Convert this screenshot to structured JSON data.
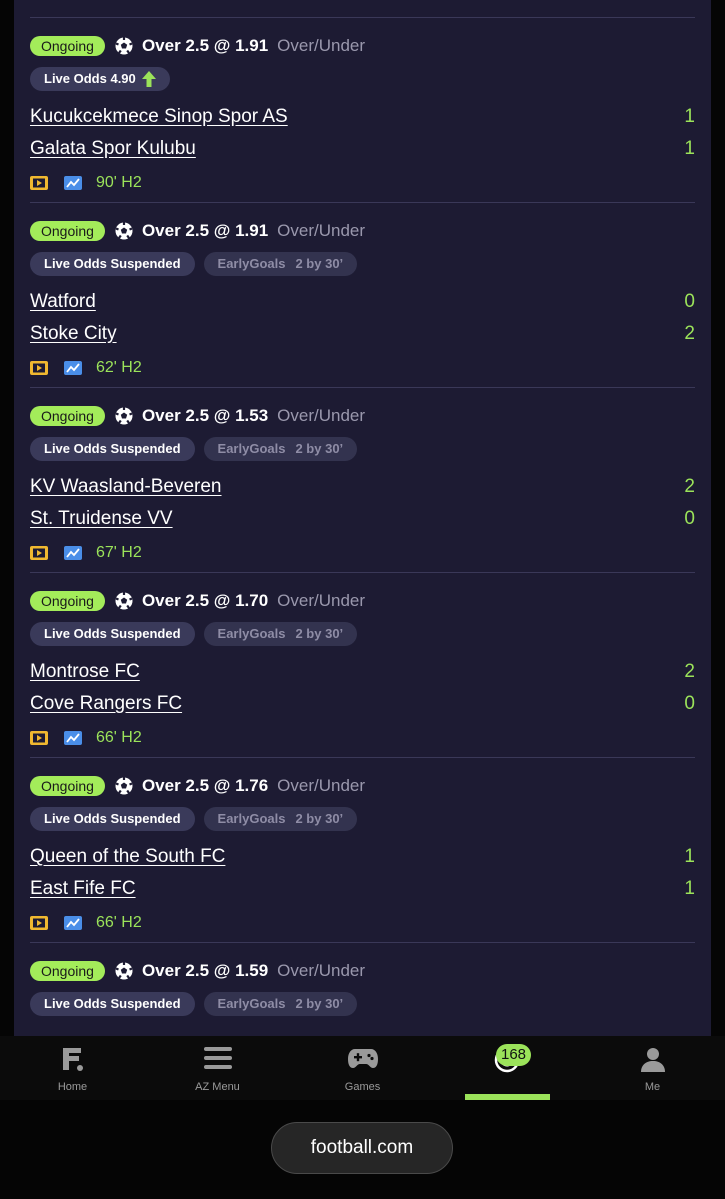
{
  "matches": [
    {
      "status": "Ongoing",
      "market": "Over 2.5 @ 1.91",
      "market_type": "Over/Under",
      "live_odds": "Live Odds 4.90",
      "odds_trend": "up",
      "early_goals": null,
      "home": "Kucukcekmece Sinop Spor AS",
      "home_score": "1",
      "away": "Galata Spor Kulubu",
      "away_score": "1",
      "minute": "90' H2"
    },
    {
      "status": "Ongoing",
      "market": "Over 2.5 @ 1.91",
      "market_type": "Over/Under",
      "live_odds": "Live Odds Suspended",
      "early_goals": {
        "label": "EarlyGoals",
        "value": "2 by 30’"
      },
      "home": "Watford",
      "home_score": "0",
      "away": "Stoke City",
      "away_score": "2",
      "minute": "62' H2"
    },
    {
      "status": "Ongoing",
      "market": "Over 2.5 @ 1.53",
      "market_type": "Over/Under",
      "live_odds": "Live Odds Suspended",
      "early_goals": {
        "label": "EarlyGoals",
        "value": "2 by 30’"
      },
      "home": "KV Waasland-Beveren",
      "home_score": "2",
      "away": "St. Truidense VV",
      "away_score": "0",
      "minute": "67' H2"
    },
    {
      "status": "Ongoing",
      "market": "Over 2.5 @ 1.70",
      "market_type": "Over/Under",
      "live_odds": "Live Odds Suspended",
      "early_goals": {
        "label": "EarlyGoals",
        "value": "2 by 30’"
      },
      "home": "Montrose FC",
      "home_score": "2",
      "away": "Cove Rangers FC",
      "away_score": "0",
      "minute": "66' H2"
    },
    {
      "status": "Ongoing",
      "market": "Over 2.5 @ 1.76",
      "market_type": "Over/Under",
      "live_odds": "Live Odds Suspended",
      "early_goals": {
        "label": "EarlyGoals",
        "value": "2 by 30’"
      },
      "home": "Queen of the South FC",
      "home_score": "1",
      "away": "East Fife FC",
      "away_score": "1",
      "minute": "66' H2"
    },
    {
      "status": "Ongoing",
      "market": "Over 2.5 @ 1.59",
      "market_type": "Over/Under",
      "live_odds": "Live Odds Suspended",
      "early_goals": {
        "label": "EarlyGoals",
        "value": "2 by 30’"
      },
      "home": "",
      "home_score": "",
      "away": "",
      "away_score": "",
      "minute": ""
    }
  ],
  "nav": {
    "items": [
      {
        "label": "Home",
        "icon": "football-logo-icon"
      },
      {
        "label": "AZ Menu",
        "icon": "menu-icon"
      },
      {
        "label": "Games",
        "icon": "gamepad-icon"
      },
      {
        "label": "",
        "icon": "cashback-icon",
        "badge": "168",
        "active": true
      },
      {
        "label": "Me",
        "icon": "user-icon"
      }
    ]
  },
  "browser": {
    "url": "football.com"
  },
  "colors": {
    "accent": "#9be35a",
    "card_bg": "#1d1b33",
    "chip_bg": "#3a3a5a",
    "tv_icon": "#f0b830",
    "chart_icon": "#4a8ee8"
  }
}
